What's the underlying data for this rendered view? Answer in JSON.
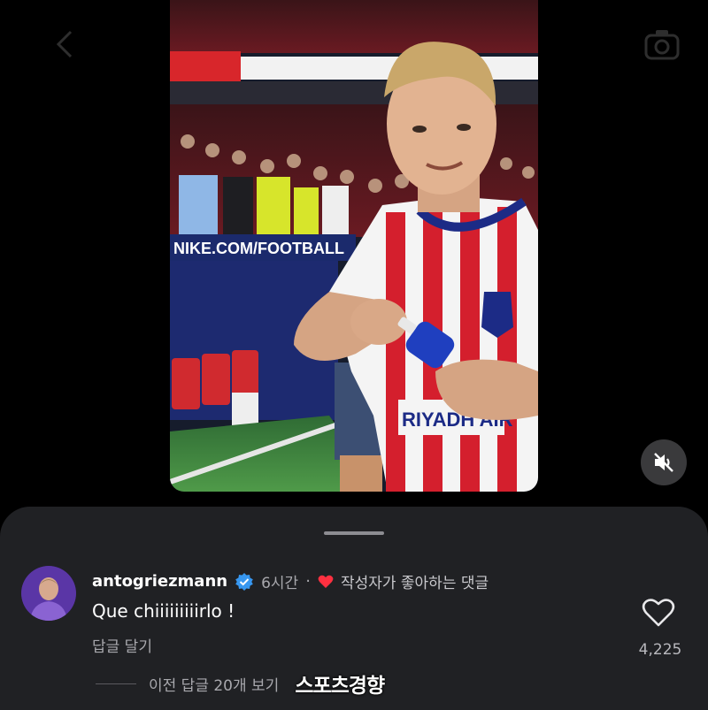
{
  "comment": {
    "username": "antogriezmann",
    "time": "6시간",
    "separator": "·",
    "liked_label": "작성자가 좋아하는 댓글",
    "text": "Que chiiiiiiiiirlo !",
    "reply_label": "답글 달기",
    "like_count": "4,225"
  },
  "replies": {
    "view_label": "이전 답글 20개 보기"
  },
  "video": {
    "banner_text": "NIKE.COM/FOOTBALL",
    "jersey_sponsor": "RIYADH AIR"
  },
  "watermark": "스포츠경향",
  "icons": {
    "back": "chevron-left-icon",
    "camera": "camera-icon",
    "mute": "speaker-muted-icon",
    "verified": "verified-badge-icon",
    "liked": "heart-filled-icon",
    "like": "heart-outline-icon"
  },
  "colors": {
    "sheet_bg": "#202124",
    "verified_blue": "#3797f0",
    "heart_red": "#ff3040",
    "secondary_text": "#a8a8ad"
  }
}
